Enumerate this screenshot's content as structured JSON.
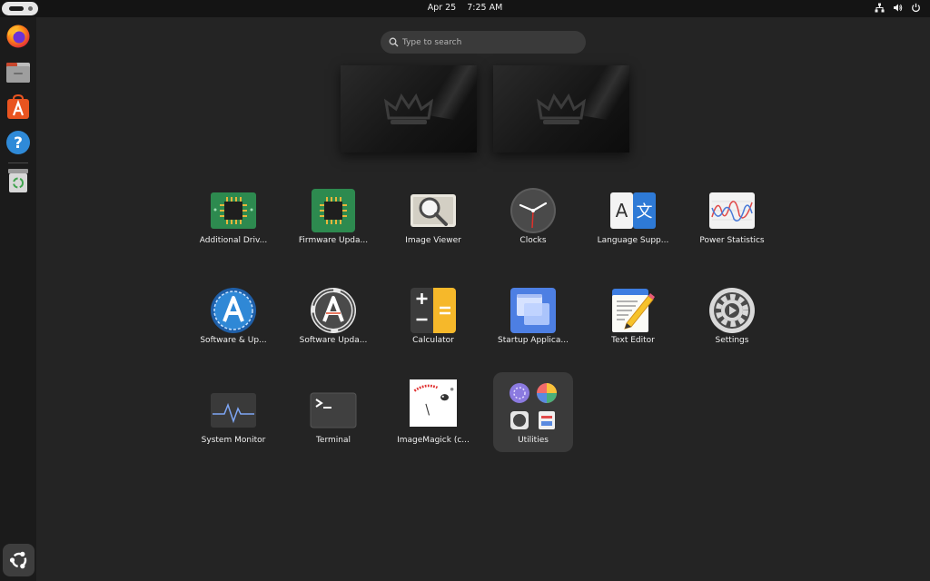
{
  "topbar": {
    "date": "Apr 25",
    "time": "7:25 AM",
    "tray_icons": [
      "network-icon",
      "volume-icon",
      "power-icon"
    ]
  },
  "dock": {
    "items": [
      {
        "name": "Firefox",
        "icon": "firefox-icon"
      },
      {
        "name": "Files",
        "icon": "files-icon"
      },
      {
        "name": "App Center",
        "icon": "app-center-icon"
      },
      {
        "name": "Help",
        "icon": "help-icon"
      },
      {
        "name": "Trash",
        "icon": "trash-icon"
      }
    ],
    "show_apps_icon": "ubuntu-logo-icon"
  },
  "search": {
    "placeholder": "Type to search",
    "value": ""
  },
  "workspaces": [
    {
      "icon": "crown-logo-icon"
    },
    {
      "icon": "crown-logo-icon"
    }
  ],
  "apps": [
    {
      "label": "Additional Driv...",
      "icon": "chip-icon"
    },
    {
      "label": "Firmware Upda...",
      "icon": "chip-icon"
    },
    {
      "label": "Image Viewer",
      "icon": "magnifier-icon"
    },
    {
      "label": "Clocks",
      "icon": "clock-icon"
    },
    {
      "label": "Language Supp...",
      "icon": "language-icon"
    },
    {
      "label": "Power Statistics",
      "icon": "graph-icon"
    },
    {
      "label": "Software & Up...",
      "icon": "software-icon"
    },
    {
      "label": "Software Upda...",
      "icon": "software-update-icon"
    },
    {
      "label": "Calculator",
      "icon": "calculator-icon"
    },
    {
      "label": "Startup Applica...",
      "icon": "startup-icon"
    },
    {
      "label": "Text Editor",
      "icon": "text-editor-icon"
    },
    {
      "label": "Settings",
      "icon": "gear-icon"
    },
    {
      "label": "System Monitor",
      "icon": "monitor-icon"
    },
    {
      "label": "Terminal",
      "icon": "terminal-icon"
    },
    {
      "label": "ImageMagick (c...",
      "icon": "imagemagick-icon"
    },
    {
      "label": "Utilities",
      "icon": "folder-icon"
    }
  ],
  "colors": {
    "background": "#242424",
    "topbar": "#141414",
    "dock": "#1b1b1b",
    "folder": "#3a3a3a",
    "accent_orange": "#e95420"
  }
}
